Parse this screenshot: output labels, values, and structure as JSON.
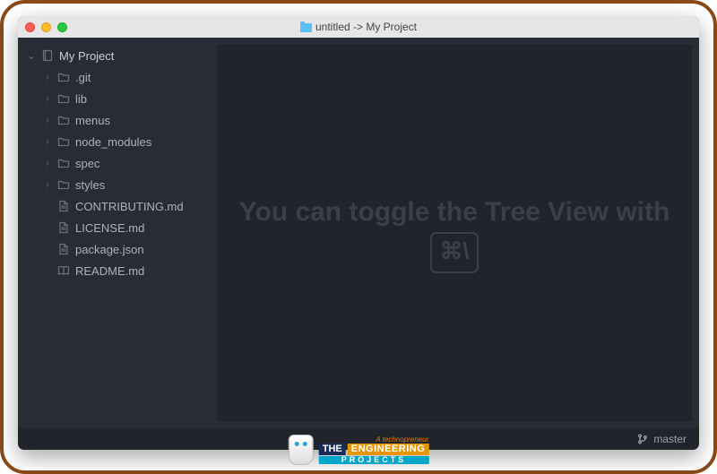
{
  "titlebar": {
    "title": "untitled -> My Project"
  },
  "tree": {
    "root": {
      "label": "My Project"
    },
    "items": [
      {
        "label": ".git",
        "type": "folder",
        "expandable": true
      },
      {
        "label": "lib",
        "type": "folder",
        "expandable": true
      },
      {
        "label": "menus",
        "type": "folder",
        "expandable": true
      },
      {
        "label": "node_modules",
        "type": "folder",
        "expandable": true
      },
      {
        "label": "spec",
        "type": "folder",
        "expandable": true
      },
      {
        "label": "styles",
        "type": "folder",
        "expandable": true
      },
      {
        "label": "CONTRIBUTING.md",
        "type": "file",
        "expandable": false
      },
      {
        "label": "LICENSE.md",
        "type": "file",
        "expandable": false
      },
      {
        "label": "package.json",
        "type": "file",
        "expandable": false
      },
      {
        "label": "README.md",
        "type": "book",
        "expandable": false
      }
    ]
  },
  "editor": {
    "hint_prefix": "You can toggle the Tree View with ",
    "hint_key": "⌘\\"
  },
  "statusbar": {
    "branch": "master"
  },
  "watermark": {
    "tagline": "A technopreneur",
    "word1": "THE",
    "word2": "ENGINEERING",
    "word3": "PROJECTS"
  }
}
